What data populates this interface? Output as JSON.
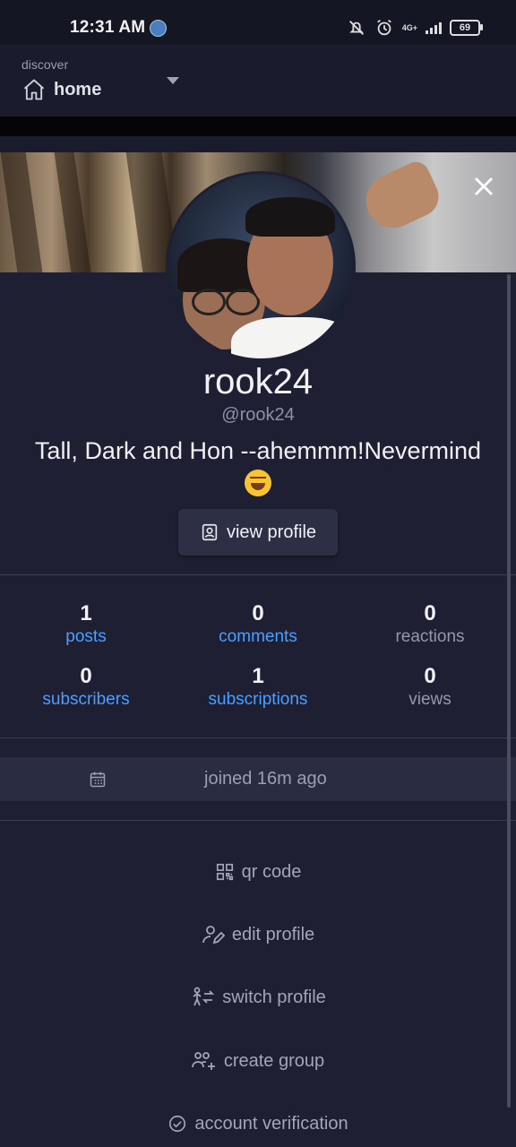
{
  "status_bar": {
    "time": "12:31 AM",
    "network": "4G+",
    "battery": "69",
    "icons": [
      "app-notification-icon",
      "muted-bell-icon",
      "alarm-icon",
      "signal-icon",
      "battery-icon"
    ]
  },
  "app_bar": {
    "section_label": "discover",
    "current": "home"
  },
  "profile": {
    "name": "rook24",
    "handle": "@rook24",
    "bio": "Tall, Dark and Hon --ahemmm!Nevermind",
    "bio_emoji": "rolling-on-floor-laughing-emoji",
    "view_profile_label": "view profile"
  },
  "stats": [
    {
      "value": "1",
      "label": "posts",
      "link": true
    },
    {
      "value": "0",
      "label": "comments",
      "link": true
    },
    {
      "value": "0",
      "label": "reactions",
      "link": false
    },
    {
      "value": "0",
      "label": "subscribers",
      "link": true
    },
    {
      "value": "1",
      "label": "subscriptions",
      "link": true
    },
    {
      "value": "0",
      "label": "views",
      "link": false
    }
  ],
  "joined": "joined 16m ago",
  "menu": [
    {
      "label": "qr code",
      "icon": "qr-code-icon"
    },
    {
      "label": "edit profile",
      "icon": "edit-profile-icon"
    },
    {
      "label": "switch profile",
      "icon": "switch-profile-icon"
    },
    {
      "label": "create group",
      "icon": "create-group-icon"
    },
    {
      "label": "account verification",
      "icon": "verified-check-icon"
    }
  ],
  "colors": {
    "background": "#1e1f33",
    "accent_link": "#4a9fff",
    "muted_text": "#9597ab",
    "joined_band": "#2a2c42"
  }
}
